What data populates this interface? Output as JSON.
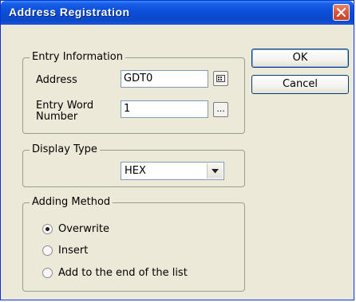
{
  "dialog": {
    "title": "Address Registration",
    "close_icon": "close-icon"
  },
  "buttons": {
    "ok": "OK",
    "cancel": "Cancel"
  },
  "entry_information": {
    "group_label": "Entry Information",
    "address_label": "Address",
    "address_value": "GDT0",
    "entry_word_label_line1": "Entry Word",
    "entry_word_label_line2": "Number",
    "entry_word_value": "1",
    "address_browse_icon": "keypad-icon",
    "entry_word_browse_label": "..."
  },
  "display_type": {
    "group_label": "Display Type",
    "selected": "HEX"
  },
  "adding_method": {
    "group_label": "Adding Method",
    "options": [
      {
        "label": "Overwrite",
        "checked": true
      },
      {
        "label": "Insert",
        "checked": false
      },
      {
        "label": "Add to the end of the list",
        "checked": false
      }
    ]
  }
}
